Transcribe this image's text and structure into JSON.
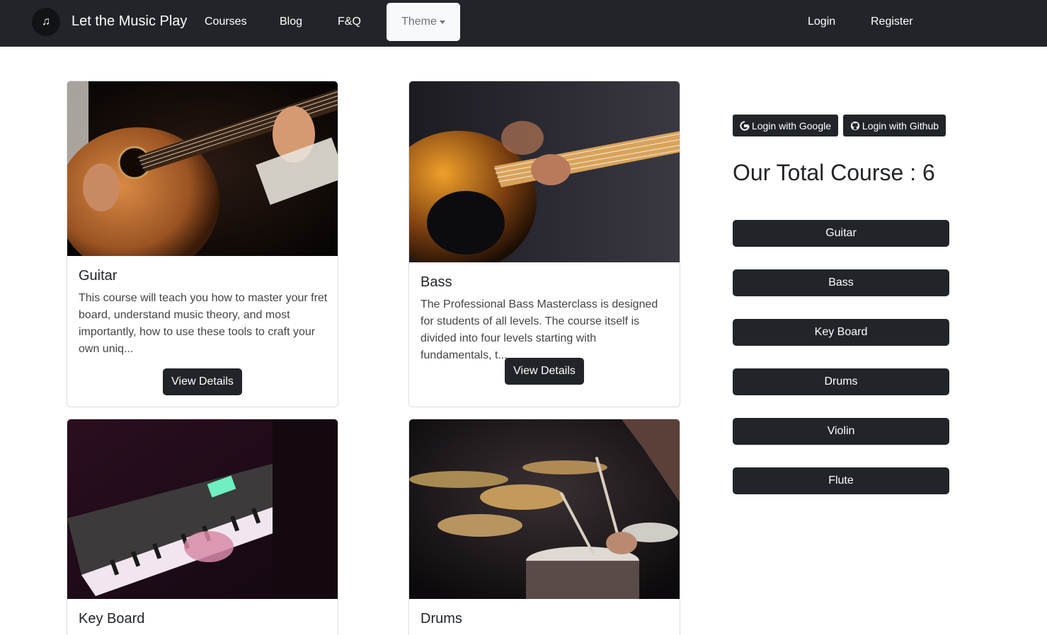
{
  "navbar": {
    "logo_glyph": "♫",
    "brand": "Let the Music Play",
    "links": {
      "courses": "Courses",
      "blog": "Blog",
      "faq": "F&Q"
    },
    "theme": "Theme",
    "login": "Login",
    "register": "Register"
  },
  "cards": [
    {
      "title": "Guitar",
      "text": "This course will teach you how to master your fret board, understand music theory, and most importantly, how to use these tools to craft your own uniq...",
      "button": "View Details"
    },
    {
      "title": "Bass",
      "text": "The Professional Bass Masterclass is designed for students of all levels. The course itself is divided into four levels starting with fundamentals, t...",
      "button": "View Details"
    },
    {
      "title": "Key Board"
    },
    {
      "title": "Drums"
    }
  ],
  "sidebar": {
    "google_button": "Login with Google",
    "github_button": "Login with Github",
    "total_label": "Our Total Course : 6",
    "courses": [
      "Guitar",
      "Bass",
      "Key Board",
      "Drums",
      "Violin",
      "Flute"
    ]
  },
  "colors": {
    "dark": "#212529",
    "theme_button_bg": "#f8f9fa",
    "theme_text": "#6c757d"
  },
  "icons": [
    "music-note-icon",
    "google-icon",
    "github-icon",
    "caret-down-icon"
  ]
}
